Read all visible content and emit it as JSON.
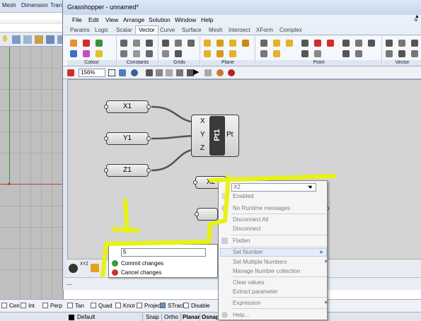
{
  "rhino": {
    "menu": [
      "Mesh",
      "Dimension",
      "Tran"
    ],
    "osnap": [
      {
        "label": "Cen",
        "checked": false
      },
      {
        "label": "Int",
        "checked": false
      },
      {
        "label": "Perp",
        "checked": false
      },
      {
        "label": "Tan",
        "checked": false
      },
      {
        "label": "Quad",
        "checked": false
      },
      {
        "label": "Knot",
        "checked": false
      },
      {
        "label": "Project",
        "checked": false
      },
      {
        "label": "STrack",
        "checked": true
      },
      {
        "label": "Disable",
        "checked": false
      }
    ],
    "status": {
      "layer": "Default",
      "snap": "Snap",
      "ortho": "Ortho",
      "planar": "Planar",
      "osnap": "Osnap"
    }
  },
  "gh": {
    "title": "Grasshopper - unnamed*",
    "menu": [
      "File",
      "Edit",
      "View",
      "Arrange",
      "Solution",
      "Window",
      "Help"
    ],
    "menu_right": "u",
    "tabs": [
      "Params",
      "Logic",
      "Scalar",
      "Vector",
      "Curve",
      "Surface",
      "Mesh",
      "Intersect",
      "XForm",
      "Complex"
    ],
    "active_tab": "Vector",
    "ribbon_groups": [
      "Colour",
      "Constants",
      "Grids",
      "Plane",
      "Point",
      "Vector"
    ],
    "zoom": "156%",
    "footer": "...",
    "params": {
      "x1": "X1",
      "y1": "Y1",
      "z1": "Z1",
      "x2": "X2"
    },
    "point_component": {
      "inputs": [
        "X",
        "Y",
        "Z"
      ],
      "name": "Pt1",
      "output": "Pt"
    },
    "colors": {
      "annotation": "#e8f213",
      "canvas": "#d4d4d4",
      "highlight": "#e3ecf8"
    }
  },
  "set_number_popup": {
    "value": "5",
    "commit": "Commit changes",
    "cancel": "Cancel changes"
  },
  "context_menu": {
    "name_field": "X2",
    "enabled": "Enabled",
    "no_runtime": "No Runtime messages",
    "disconnect_all": "Disconnect All",
    "disconnect": "Disconnect",
    "flatten": "Flatten",
    "set_number": "Set Number",
    "set_multiple": "Set Multiple Numbers",
    "manage": "Manage Number collection",
    "clear_values": "Clear values",
    "extract": "Extract parameter",
    "expression": "Expression",
    "help": "Help..."
  }
}
